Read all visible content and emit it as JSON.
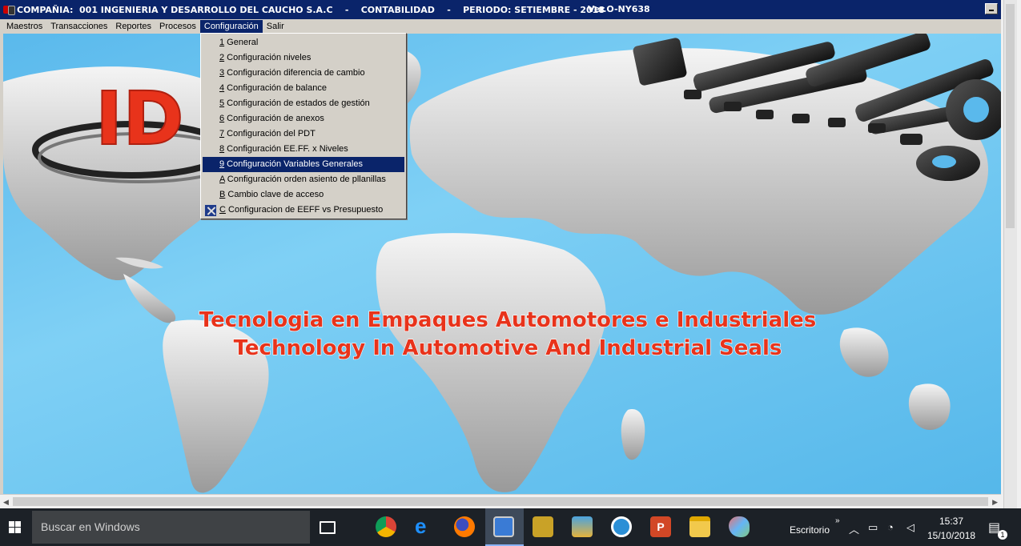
{
  "window": {
    "title": "COMPAÑIA:  001 INGENIERIA Y DESARROLLO DEL CAUCHO S.A.C    -    CONTABILIDAD    -    PERIODO: SETIEMBRE - 2018",
    "version": "Ver.O-NY638"
  },
  "menubar": {
    "items": [
      "Maestros",
      "Transacciones",
      "Reportes",
      "Procesos",
      "Configuración",
      "Salir"
    ],
    "active": "Configuración"
  },
  "dropdown": {
    "items": [
      {
        "key": "1",
        "label": " General"
      },
      {
        "key": "2",
        "label": " Configuración niveles"
      },
      {
        "key": "3",
        "label": " Configuración diferencia de cambio"
      },
      {
        "key": "4",
        "label": " Configuración de balance"
      },
      {
        "key": "5",
        "label": " Configuración de estados de gestión"
      },
      {
        "key": "6",
        "label": " Configuración de anexos"
      },
      {
        "key": "7",
        "label": " Configuración del PDT"
      },
      {
        "key": "8",
        "label": " Configuración EE.FF. x Niveles"
      },
      {
        "key": "9",
        "label": " Configuración Variables Generales"
      },
      {
        "key": "A",
        "label": " Configuración orden asiento de pllanillas"
      },
      {
        "key": "B",
        "label": " Cambio clave de acceso"
      },
      {
        "key": "C",
        "label": " Configuracion de EEFF vs Presupuesto"
      }
    ],
    "highlighted_index": 8,
    "icon_item_index": 11,
    "icon_name": "tools-icon"
  },
  "banner": {
    "logo_text": "ID",
    "line1": "Tecnologia en Empaques Automotores e Industriales",
    "line2": "Technology In Automotive And Industrial Seals"
  },
  "taskbar": {
    "search_placeholder": "Buscar en Windows",
    "desktop_label": "Escritorio",
    "time": "15:37",
    "date": "15/10/2018",
    "notification_count": "1"
  },
  "colors": {
    "title_bar": "#0a246a",
    "menu_bg": "#d4d0c8",
    "highlight": "#0a246a",
    "banner_text": "#e8331b",
    "ocean": "#5ab9ec",
    "taskbar": "#1c2127"
  }
}
